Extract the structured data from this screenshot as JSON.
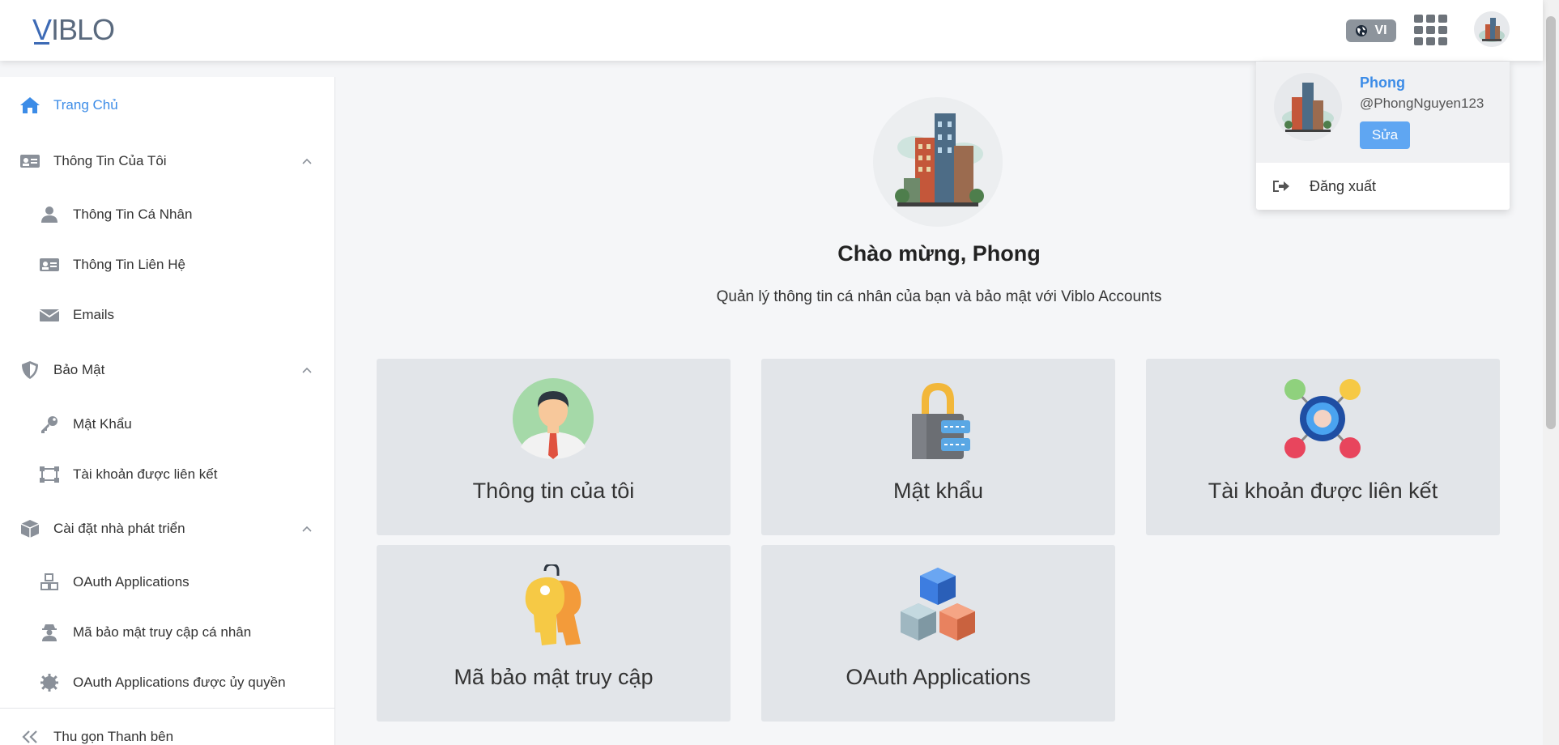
{
  "header": {
    "logo": "VIBLO",
    "logo_v": "V",
    "logo_rest": "IBLO",
    "language": "VI"
  },
  "sidebar": {
    "home": "Trang Chủ",
    "my_info": "Thông Tin Của Tôi",
    "personal_info": "Thông Tin Cá Nhân",
    "contact_info": "Thông Tin Liên Hệ",
    "emails": "Emails",
    "security": "Bảo Mật",
    "password": "Mật Khẩu",
    "linked_accounts": "Tài khoản được liên kết",
    "developer_settings": "Cài đặt nhà phát triển",
    "oauth_apps": "OAuth Applications",
    "personal_access_tokens": "Mã bảo mật truy cập cá nhân",
    "authorized_oauth_apps": "OAuth Applications được ủy quyền",
    "collapse": "Thu gọn Thanh bên"
  },
  "main": {
    "welcome": "Chào mừng, Phong",
    "subtitle": "Quản lý thông tin cá nhân của bạn và bảo mật với Viblo Accounts",
    "cards": [
      {
        "title": "Thông tin của tôi",
        "icon": "user-avatar-icon"
      },
      {
        "title": "Mật khẩu",
        "icon": "padlock-icon"
      },
      {
        "title": "Tài khoản được liên kết",
        "icon": "linked-network-icon"
      },
      {
        "title": "Mã bảo mật truy cập",
        "icon": "keys-icon"
      },
      {
        "title": "OAuth Applications",
        "icon": "cubes-icon"
      }
    ]
  },
  "dropdown": {
    "name": "Phong",
    "handle": "@PhongNguyen123",
    "edit": "Sửa",
    "logout": "Đăng xuất"
  },
  "colors": {
    "accent": "#3c8ce7",
    "card_bg": "#e2e5e9",
    "edit_button": "#5fa6f2"
  }
}
